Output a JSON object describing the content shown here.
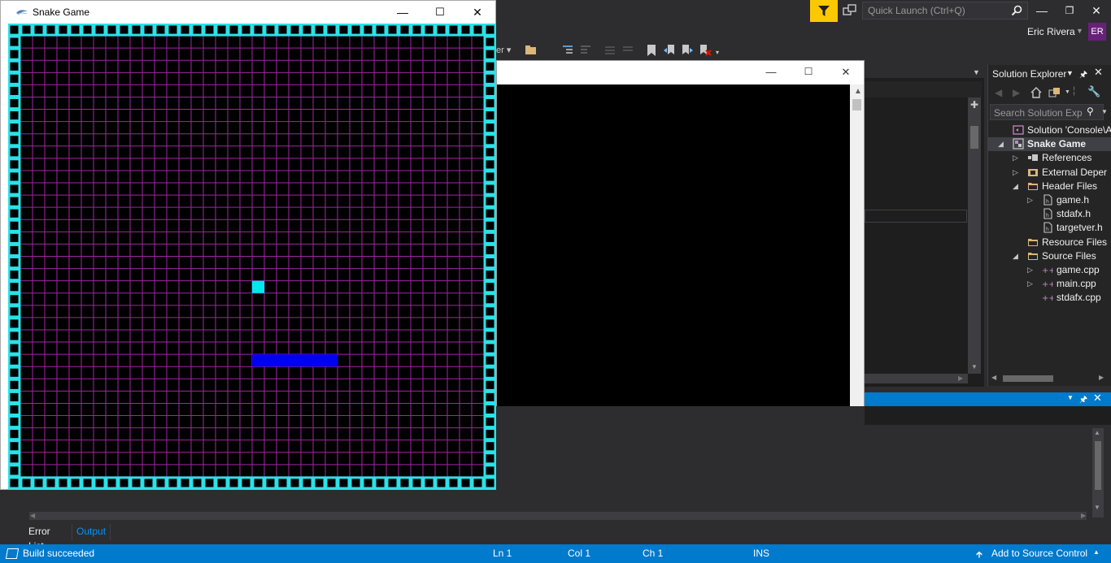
{
  "vs": {
    "quick_launch_placeholder": "Quick Launch (Ctrl+Q)",
    "user_name": "Eric Rivera",
    "user_initials": "ER",
    "accent_color": "#fcc900",
    "avatar_color": "#68217a"
  },
  "solution_explorer": {
    "title": "Solution Explorer",
    "search_placeholder": "Search Solution Exp",
    "items": [
      {
        "label": "Solution 'Console\\App",
        "icon": "solution-icon",
        "indent": 0,
        "expander": ""
      },
      {
        "label": "Snake Game",
        "icon": "project-icon",
        "indent": 1,
        "expander": "expanded",
        "bold": true,
        "selected": true
      },
      {
        "label": "References",
        "icon": "references-icon",
        "indent": 2,
        "expander": "collapsed"
      },
      {
        "label": "External Deper",
        "icon": "external-deps-icon",
        "indent": 2,
        "expander": "collapsed"
      },
      {
        "label": "Header Files",
        "icon": "folder-icon",
        "indent": 2,
        "expander": "expanded"
      },
      {
        "label": "game.h",
        "icon": "header-file-icon",
        "indent": 3,
        "expander": "collapsed"
      },
      {
        "label": "stdafx.h",
        "icon": "header-file-icon",
        "indent": 3,
        "expander": ""
      },
      {
        "label": "targetver.h",
        "icon": "header-file-icon",
        "indent": 3,
        "expander": ""
      },
      {
        "label": "Resource Files",
        "icon": "folder-icon",
        "indent": 2,
        "expander": ""
      },
      {
        "label": "Source Files",
        "icon": "folder-icon",
        "indent": 2,
        "expander": "expanded"
      },
      {
        "label": "game.cpp",
        "icon": "cpp-file-icon",
        "indent": 3,
        "expander": "collapsed"
      },
      {
        "label": "main.cpp",
        "icon": "cpp-file-icon",
        "indent": 3,
        "expander": "collapsed"
      },
      {
        "label": "stdafx.cpp",
        "icon": "cpp-file-icon",
        "indent": 3,
        "expander": ""
      }
    ]
  },
  "bottom_tabs": {
    "error_list": "Error List",
    "output": "Output"
  },
  "status_bar": {
    "message": "Build succeeded",
    "line": "Ln 1",
    "col": "Col 1",
    "ch": "Ch 1",
    "mode": "INS",
    "source_control": "Add to Source Control",
    "color": "#007acc"
  },
  "snake_window": {
    "title": "Snake Game",
    "board": {
      "cols": 40,
      "rows": 38,
      "grid_color": "#a0279f",
      "wall_color": "#2ae2e8",
      "food_color": "#00e8ef",
      "snake_color": "#0000f0",
      "food": {
        "col": 20,
        "row": 21
      },
      "snake_cells": [
        [
          20,
          27
        ],
        [
          21,
          27
        ],
        [
          22,
          27
        ],
        [
          23,
          27
        ],
        [
          24,
          27
        ],
        [
          25,
          27
        ],
        [
          26,
          27
        ]
      ]
    }
  }
}
